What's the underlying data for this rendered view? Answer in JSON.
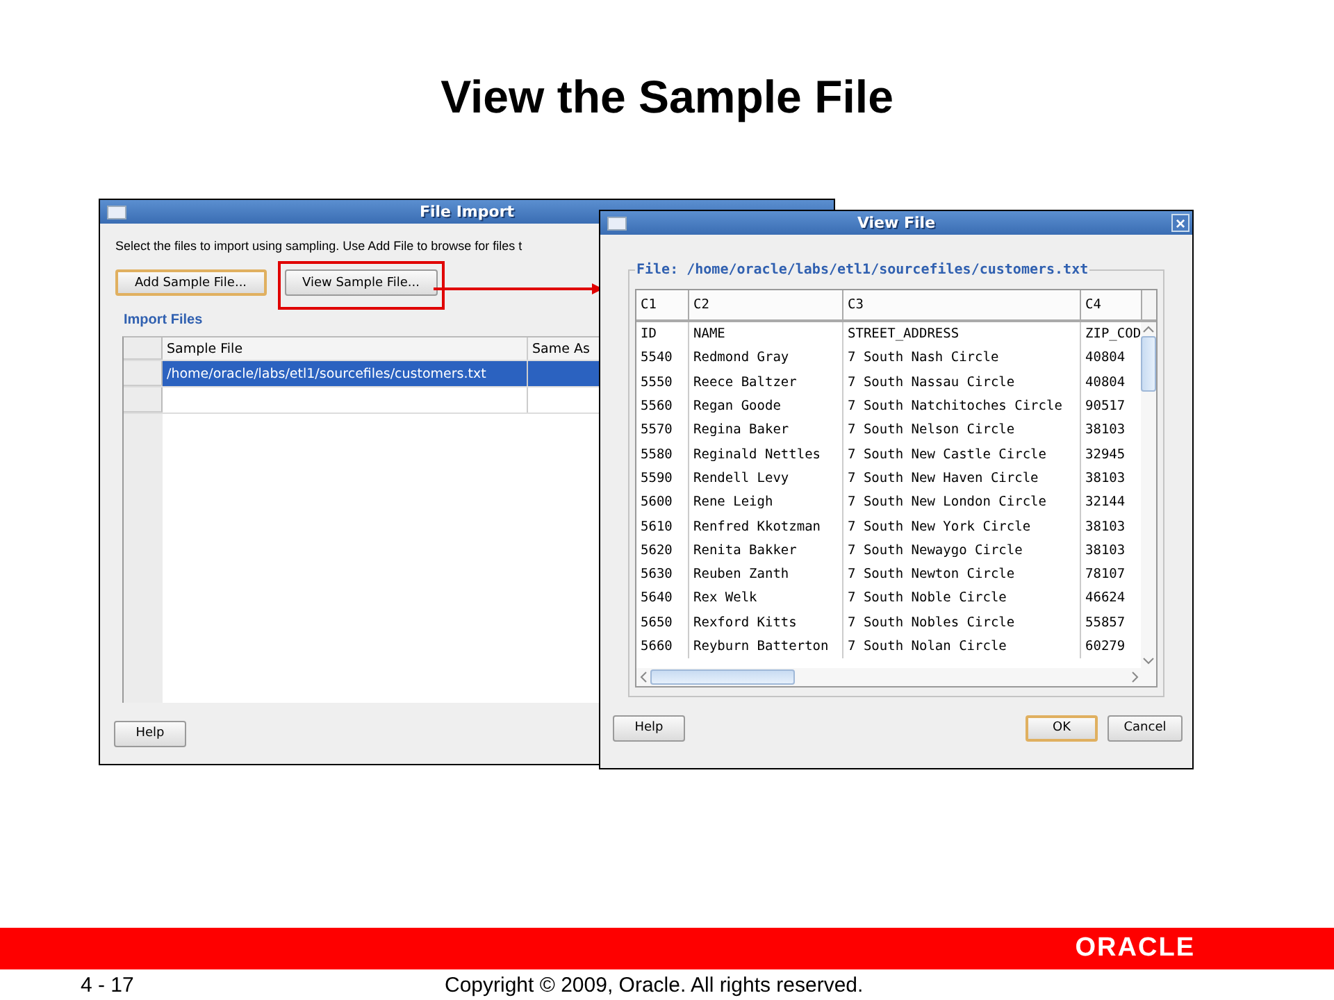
{
  "slide": {
    "title": "View the Sample File"
  },
  "file_import": {
    "title": "File Import",
    "instruction": "Select the files to import using sampling.  Use Add File to browse for files t",
    "buttons": [
      {
        "label": "Add Sample File...",
        "default": true,
        "highlighted": false
      },
      {
        "label": "View Sample File...",
        "default": false,
        "highlighted": true
      }
    ],
    "section_label": "Import Files",
    "columns": [
      "Sample File",
      "Same As"
    ],
    "rows": [
      {
        "sample_file": "/home/oracle/labs/etl1/sourcefiles/customers.txt",
        "selected": true
      }
    ],
    "help_button": "Help"
  },
  "view_file": {
    "title": "View File",
    "close_icon": "×",
    "group_label": "File: /home/oracle/labs/etl1/sourcefiles/customers.txt",
    "columns": [
      "C1",
      "C2",
      "C3",
      "C4"
    ],
    "rows": [
      [
        "ID",
        "NAME",
        "STREET_ADDRESS",
        "ZIP_COD"
      ],
      [
        "5540",
        "Redmond Gray",
        "7 South Nash Circle",
        "40804"
      ],
      [
        "5550",
        "Reece Baltzer",
        "7 South Nassau Circle",
        "40804"
      ],
      [
        "5560",
        "Regan Goode",
        "7 South Natchitoches Circle",
        "90517"
      ],
      [
        "5570",
        "Regina Baker",
        "7 South Nelson Circle",
        "38103"
      ],
      [
        "5580",
        "Reginald Nettles",
        "7 South New Castle Circle",
        "32945"
      ],
      [
        "5590",
        "Rendell Levy",
        "7 South New Haven Circle",
        "38103"
      ],
      [
        "5600",
        "Rene Leigh",
        "7 South New London Circle",
        "32144"
      ],
      [
        "5610",
        "Renfred Kkotzman",
        "7 South New York Circle",
        "38103"
      ],
      [
        "5620",
        "Renita Bakker",
        "7 South Newaygo Circle",
        "38103"
      ],
      [
        "5630",
        "Reuben Zanth",
        "7 South Newton Circle",
        "78107"
      ],
      [
        "5640",
        "Rex Welk",
        "7 South Noble Circle",
        "46624"
      ],
      [
        "5650",
        "Rexford Kitts",
        "7 South Nobles Circle",
        "55857"
      ],
      [
        "5660",
        "Reyburn Batterton",
        "7 South Nolan Circle",
        "60279"
      ]
    ],
    "buttons": [
      {
        "label": "Help",
        "default": false
      },
      {
        "label": "OK",
        "default": true
      },
      {
        "label": "Cancel",
        "default": false
      }
    ]
  },
  "footer": {
    "logo": "ORACLE",
    "page_number": "4 - 17",
    "copyright": "Copyright © 2009, Oracle. All rights reserved."
  }
}
